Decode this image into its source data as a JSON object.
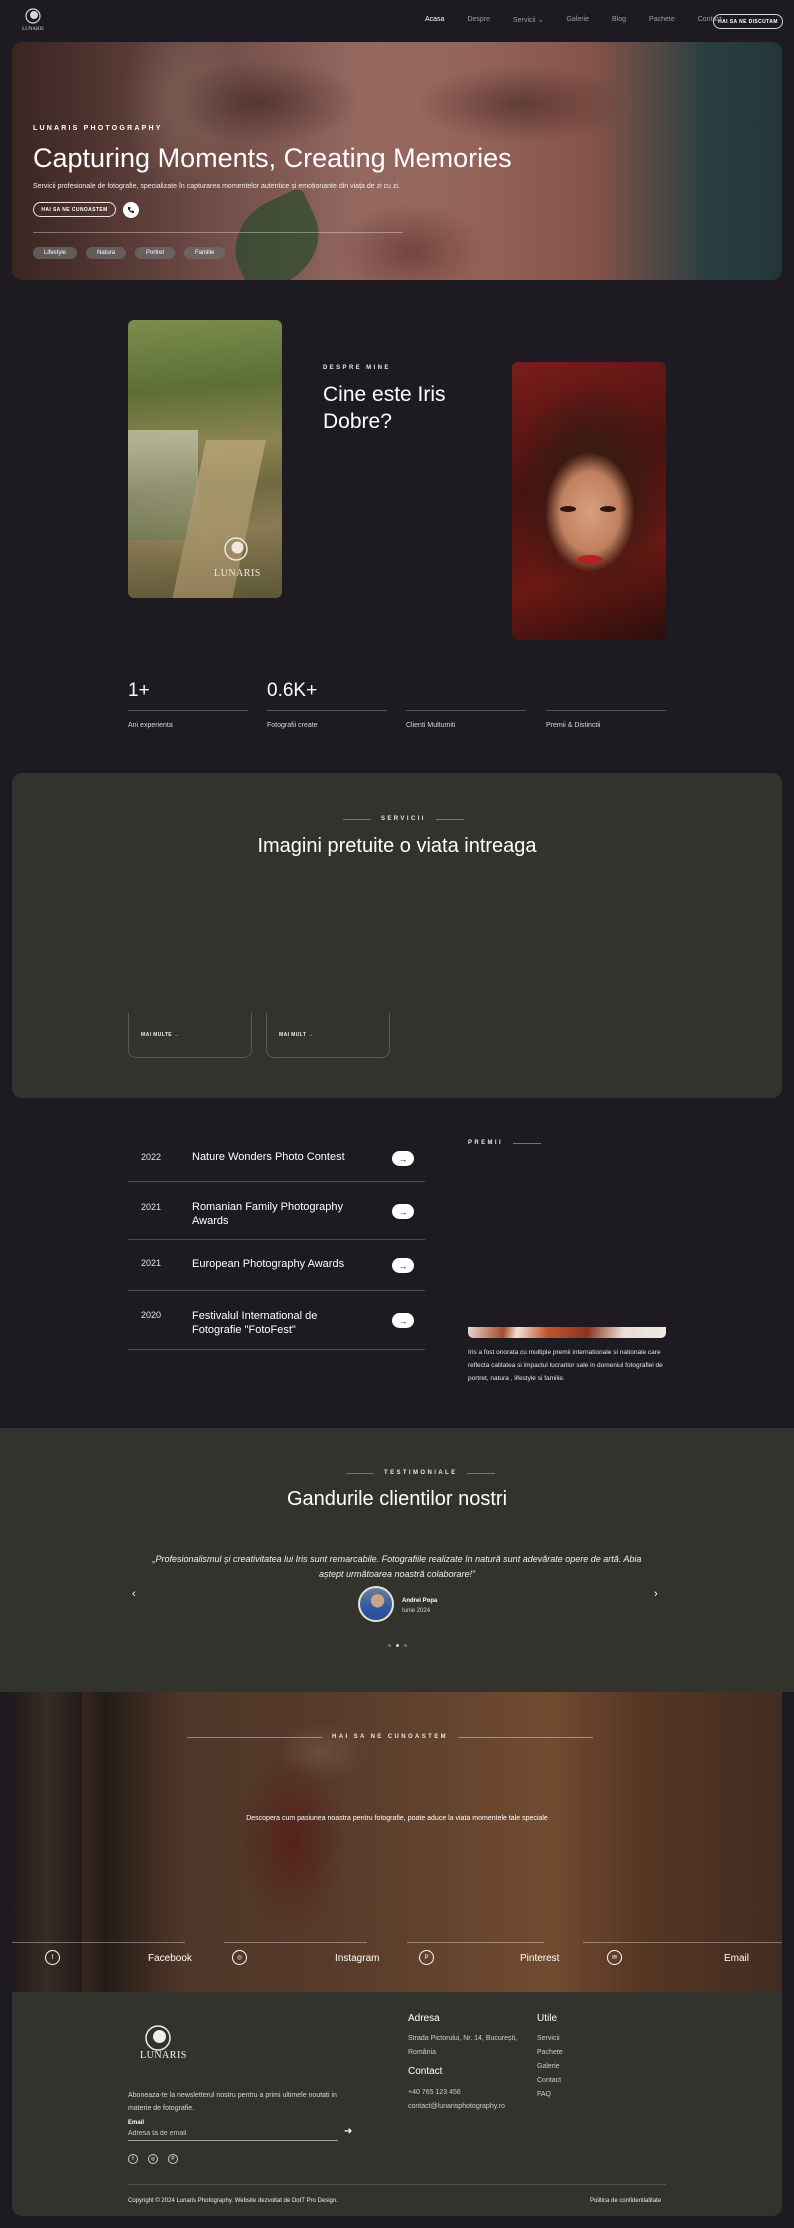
{
  "nav": {
    "logo_text": "LUNARIS",
    "links": [
      "Acasa",
      "Despre",
      "Servicii",
      "Galerie",
      "Blog",
      "Pachete",
      "Contact"
    ],
    "active_index": 0,
    "cta": "HAI SA NE DISCUTAM"
  },
  "hero": {
    "eyebrow": "LUNARIS PHOTOGRAPHY",
    "title": "Capturing Moments, Creating Memories",
    "subtitle": "Servicii profesionale de fotografie, specializate în capturarea momentelor autentice și emoționante din viața de zi cu zi.",
    "cta": "HAI SA NE CUNOASTEM",
    "tags": [
      "Lifestyle",
      "Natura",
      "Portret",
      "Familie"
    ]
  },
  "about": {
    "logo_text": "LUNARIS",
    "eyebrow": "DESPRE MINE",
    "title": "Cine este Iris Dobre?",
    "stats": [
      {
        "value": "1+",
        "label": "Ani experienta"
      },
      {
        "value": "0.6K+",
        "label": "Fotografii create"
      },
      {
        "value": "",
        "label": "Clienti Multumiti"
      },
      {
        "value": "",
        "label": "Premii & Distinctii"
      }
    ]
  },
  "services": {
    "eyebrow": "SERVICII",
    "title": "Imagini pretuite o viata intreaga",
    "cards": [
      {
        "more": "MAI MULTE"
      },
      {
        "more": "MAI MULT"
      }
    ]
  },
  "awards": {
    "eyebrow": "PREMII",
    "items": [
      {
        "year": "2022",
        "name": "Nature Wonders Photo Contest"
      },
      {
        "year": "2021",
        "name": "Romanian Family Photography Awards"
      },
      {
        "year": "2021",
        "name": "European Photography Awards"
      },
      {
        "year": "2020",
        "name": "Festivalul International de Fotografie \"FotoFest\""
      }
    ],
    "description": "Iris a fost onorata cu multiple premii internationale si nationale care reflecta calitatea si impactul lucrarilor sale in domeniul fotografiei de portret, natura , lifestyle si familie."
  },
  "testimonials": {
    "eyebrow": "TESTIMONIALE",
    "title": "Gandurile clientilor nostri",
    "quote": "„Profesionalismul și creativitatea lui Iris sunt remarcabile. Fotografiile realizate în natură sunt adevărate opere de artă. Abia aștept următoarea noastră colaborare!”",
    "author": "Andrei Popa",
    "date": "Iunie 2024",
    "dots": 3,
    "active_dot": 1
  },
  "contact_banner": {
    "eyebrow": "HAI SA NE CUNOASTEM",
    "text": "Descopera cum pasiunea noastra pentru fotografie, poate aduce la viata momentele tale speciale",
    "socials": [
      {
        "icon": "facebook-icon",
        "glyph": "f",
        "label": "Facebook"
      },
      {
        "icon": "instagram-icon",
        "glyph": "◎",
        "label": "Instagram"
      },
      {
        "icon": "pinterest-icon",
        "glyph": "P",
        "label": "Pinterest"
      },
      {
        "icon": "email-icon",
        "glyph": "✉",
        "label": "Email"
      }
    ]
  },
  "footer": {
    "logo_text": "LUNARIS",
    "newsletter": "Aboneaza-te la newsletterul nostru pentru a primi ultimele noutati in materie de fotografie.",
    "email_label": "Email",
    "email_placeholder": "Adresa ta de email",
    "address_title": "Adresa",
    "address": "Strada Pictorului, Nr. 14, București, România",
    "contact_title": "Contact",
    "phone": "+40 765 123 456",
    "email": "contact@lunarisphotography.ro",
    "useful_title": "Utile",
    "useful_links": [
      "Servicii",
      "Pachete",
      "Galerie",
      "Contact",
      "FAQ"
    ],
    "copyright": "Copyright © 2024 Lunaris Photography. Website dezvoltat de DotT Pro Design.",
    "privacy": "Politica de confidentialitate"
  },
  "colors": {
    "background": "#1d1b21",
    "panel": "#33332e",
    "text": "#e8e6e3",
    "accent_white": "#ffffff"
  }
}
